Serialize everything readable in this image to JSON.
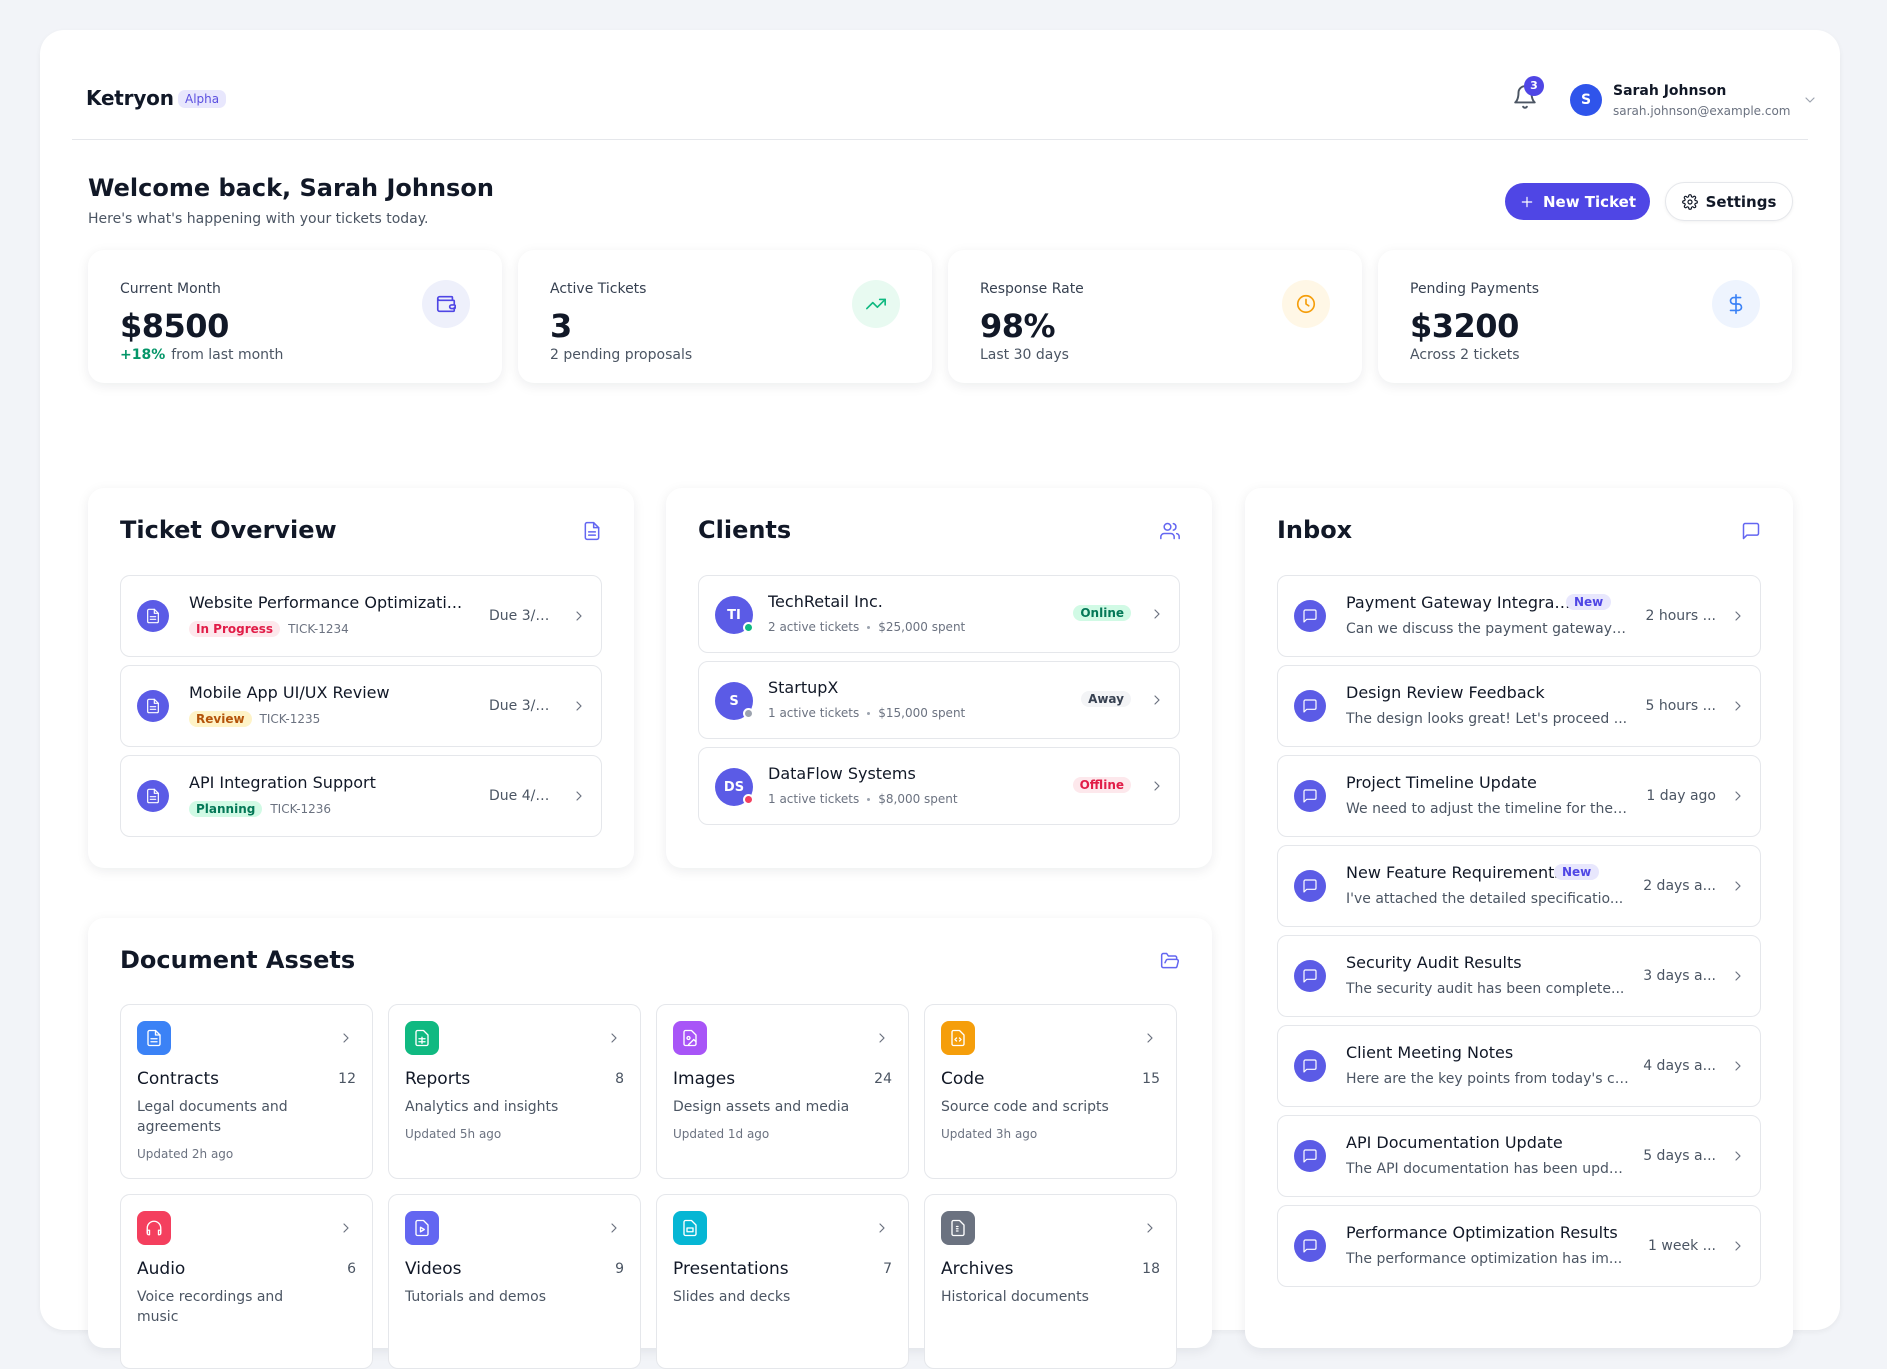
{
  "header": {
    "brand": "Ketryon",
    "brand_badge": "Alpha",
    "notification_count": "3",
    "user": {
      "initial": "S",
      "name": "Sarah Johnson",
      "email": "sarah.johnson@example.com"
    }
  },
  "welcome": {
    "title": "Welcome back, Sarah Johnson",
    "subtitle": "Here's what's happening with your tickets today.",
    "new_ticket_label": "New Ticket",
    "settings_label": "Settings"
  },
  "stats": [
    {
      "label": "Current Month",
      "value": "$8500",
      "change": "+18%",
      "sub": "from last month",
      "icon": "wallet-icon"
    },
    {
      "label": "Active Tickets",
      "value": "3",
      "sub": "2 pending proposals",
      "icon": "trending-up-icon"
    },
    {
      "label": "Response Rate",
      "value": "98%",
      "sub": "Last 30 days",
      "icon": "clock-icon"
    },
    {
      "label": "Pending Payments",
      "value": "$3200",
      "sub": "Across 2 tickets",
      "icon": "dollar-icon"
    }
  ],
  "tickets": {
    "title": "Ticket Overview",
    "items": [
      {
        "title": "Website Performance Optimizati...",
        "status": "In Progress",
        "id": "TICK-1234",
        "due": "Due 3/1..."
      },
      {
        "title": "Mobile App UI/UX Review",
        "status": "Review",
        "id": "TICK-1235",
        "due": "Due 3/1..."
      },
      {
        "title": "API Integration Support",
        "status": "Planning",
        "id": "TICK-1236",
        "due": "Due 4/1/..."
      }
    ]
  },
  "clients": {
    "title": "Clients",
    "items": [
      {
        "initials": "TI",
        "name": "TechRetail Inc.",
        "tickets": "2 active tickets",
        "spent": "$25,000 spent",
        "status": "Online"
      },
      {
        "initials": "S",
        "name": "StartupX",
        "tickets": "1 active tickets",
        "spent": "$15,000 spent",
        "status": "Away"
      },
      {
        "initials": "DS",
        "name": "DataFlow Systems",
        "tickets": "1 active tickets",
        "spent": "$8,000 spent",
        "status": "Offline"
      }
    ]
  },
  "inbox": {
    "title": "Inbox",
    "new_label": "New",
    "items": [
      {
        "title": "Payment Gateway Integrat...",
        "preview": "Can we discuss the payment gateway i...",
        "time": "2 hours ...",
        "is_new": true
      },
      {
        "title": "Design Review Feedback",
        "preview": "The design looks great! Let's proceed ...",
        "time": "5 hours ...",
        "is_new": false
      },
      {
        "title": "Project Timeline Update",
        "preview": "We need to adjust the timeline for the ...",
        "time": "1 day ago",
        "is_new": false
      },
      {
        "title": "New Feature Requirements",
        "preview": "I've attached the detailed specificatio...",
        "time": "2 days a...",
        "is_new": true
      },
      {
        "title": "Security Audit Results",
        "preview": "The security audit has been complete...",
        "time": "3 days a...",
        "is_new": false
      },
      {
        "title": "Client Meeting Notes",
        "preview": "Here are the key points from today's cl...",
        "time": "4 days a...",
        "is_new": false
      },
      {
        "title": "API Documentation Update",
        "preview": "The API documentation has been upda...",
        "time": "5 days a...",
        "is_new": false
      },
      {
        "title": "Performance Optimization Results",
        "preview": "The performance optimization has im...",
        "time": "1 week ...",
        "is_new": false
      }
    ]
  },
  "documents": {
    "title": "Document Assets",
    "items": [
      {
        "name": "Contracts",
        "count": "12",
        "desc": "Legal documents and agreements",
        "updated": "Updated 2h ago",
        "color": "#3b82f6",
        "icon": "file-text-icon"
      },
      {
        "name": "Reports",
        "count": "8",
        "desc": "Analytics and insights",
        "updated": "Updated 5h ago",
        "color": "#10b981",
        "icon": "spreadsheet-icon"
      },
      {
        "name": "Images",
        "count": "24",
        "desc": "Design assets and media",
        "updated": "Updated 1d ago",
        "color": "#a855f7",
        "icon": "image-icon"
      },
      {
        "name": "Code",
        "count": "15",
        "desc": "Source code and scripts",
        "updated": "Updated 3h ago",
        "color": "#f59e0b",
        "icon": "code-icon"
      },
      {
        "name": "Audio",
        "count": "6",
        "desc": "Voice recordings and music",
        "updated": "",
        "color": "#f43f5e",
        "icon": "headphones-icon"
      },
      {
        "name": "Videos",
        "count": "9",
        "desc": "Tutorials and demos",
        "updated": "",
        "color": "#6366f1",
        "icon": "video-icon"
      },
      {
        "name": "Presentations",
        "count": "7",
        "desc": "Slides and decks",
        "updated": "",
        "color": "#06b6d4",
        "icon": "presentation-icon"
      },
      {
        "name": "Archives",
        "count": "18",
        "desc": "Historical documents",
        "updated": "",
        "color": "#6b7280",
        "icon": "archive-icon"
      }
    ]
  },
  "colors": {
    "primary": "#4f46e5",
    "online": "#10b981",
    "away": "#9ca3af",
    "offline": "#f43f5e"
  }
}
